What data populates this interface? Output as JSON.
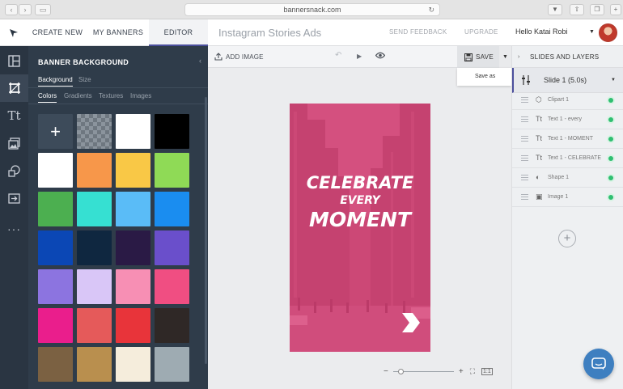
{
  "browser": {
    "url": "bannersnack.com"
  },
  "topbar": {
    "tabs": [
      {
        "label": "CREATE NEW"
      },
      {
        "label": "MY BANNERS"
      },
      {
        "label": "EDITOR"
      }
    ],
    "document_title": "Instagram Stories Ads",
    "send_feedback": "SEND FEEDBACK",
    "upgrade": "UPGRADE",
    "greeting": "Hello  Katai Robi"
  },
  "panel": {
    "title": "BANNER BACKGROUND",
    "tabs": [
      {
        "label": "Background"
      },
      {
        "label": "Size"
      }
    ],
    "subtabs": [
      {
        "label": "Colors"
      },
      {
        "label": "Gradients"
      },
      {
        "label": "Textures"
      },
      {
        "label": "Images"
      }
    ],
    "swatch_colors": [
      "#ffffff",
      "#000000",
      "#ffffff",
      "#f7974a",
      "#f9c846",
      "#8fda56",
      "#4caf50",
      "#36e0d2",
      "#5abcf7",
      "#1a8df0",
      "#0b47b5",
      "#0f2740",
      "#2a1a45",
      "#6a4fcb",
      "#8c74e0",
      "#d9c6f7",
      "#f78fb4",
      "#f04e82",
      "#ea1e8c",
      "#e55a5a",
      "#e8343a",
      "#2f2826",
      "#7b6142",
      "#b98f4e",
      "#f5eddc",
      "#9eabb2"
    ]
  },
  "canvas_toolbar": {
    "add_image": "ADD IMAGE",
    "save": "SAVE",
    "save_as": "Save as"
  },
  "banner": {
    "line1": "CELEBRATE",
    "line2": "EVERY",
    "line3": "MOMENT",
    "overlay_color": "#d9306e"
  },
  "layers_panel": {
    "title": "SLIDES AND LAYERS",
    "slide_label": "Slide 1 (5.0s)",
    "layers": [
      {
        "name": "Clipart 1",
        "icon": "clipart-icon"
      },
      {
        "name": "Text 1 - every",
        "icon": "text-icon"
      },
      {
        "name": "Text 1 - MOMENT",
        "icon": "text-icon"
      },
      {
        "name": "Text 1 - CELEBRATE",
        "icon": "text-icon"
      },
      {
        "name": "Shape 1",
        "icon": "shape-icon"
      },
      {
        "name": "Image 1",
        "icon": "image-icon"
      }
    ]
  },
  "accent_color": "#4b4f9c"
}
